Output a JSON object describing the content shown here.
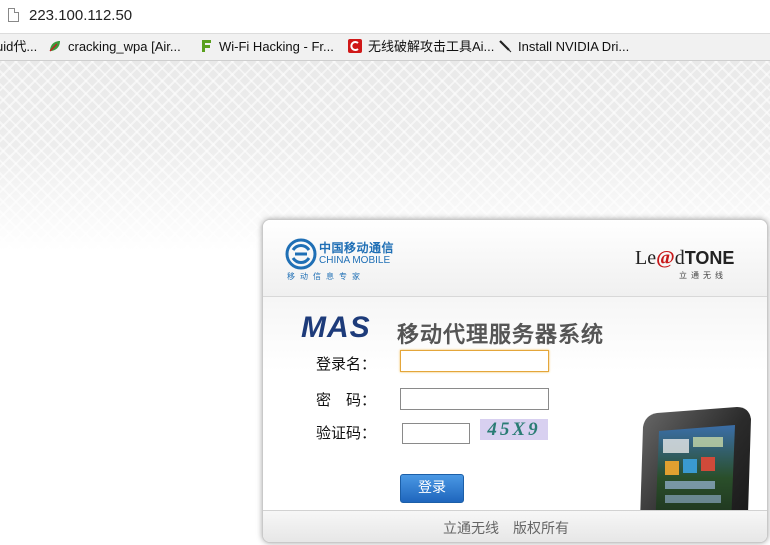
{
  "browser": {
    "url": "223.100.112.50",
    "bookmarks": [
      {
        "label": "uid代...",
        "icon": "none"
      },
      {
        "label": "cracking_wpa [Air...",
        "icon": "bookmark-leaf-icon"
      },
      {
        "label": "Wi-Fi Hacking - Fr...",
        "icon": "letter-f-icon"
      },
      {
        "label": "无线破解攻击工具Ai...",
        "icon": "letter-c-icon"
      },
      {
        "label": "Install NVIDIA Dri...",
        "icon": "pen-icon"
      }
    ]
  },
  "header": {
    "china_mobile_cn": "中国移动通信",
    "china_mobile_en": "CHINA MOBILE",
    "china_mobile_slogan": "移动信息专家",
    "leadtone_le": "Le",
    "leadtone_at": "@",
    "leadtone_d": "d",
    "leadtone_tone": "TONE",
    "leadtone_sub": "立通无线"
  },
  "login": {
    "brand": "MAS",
    "system_title": "移动代理服务器系统",
    "username_label": "登录名：",
    "password_label": "密　码：",
    "captcha_label": "验证码：",
    "username_value": "",
    "password_value": "",
    "captcha_value": "",
    "captcha_text": "45X9",
    "submit_label": "登录"
  },
  "footer": {
    "text": "立通无线　版权所有"
  },
  "colors": {
    "brand_blue": "#1d3b7a",
    "china_mobile_blue": "#1f6fb5",
    "leadtone_red": "#c8191a",
    "button_blue": "#1f66bd",
    "focus_orange": "#e4a63a"
  }
}
